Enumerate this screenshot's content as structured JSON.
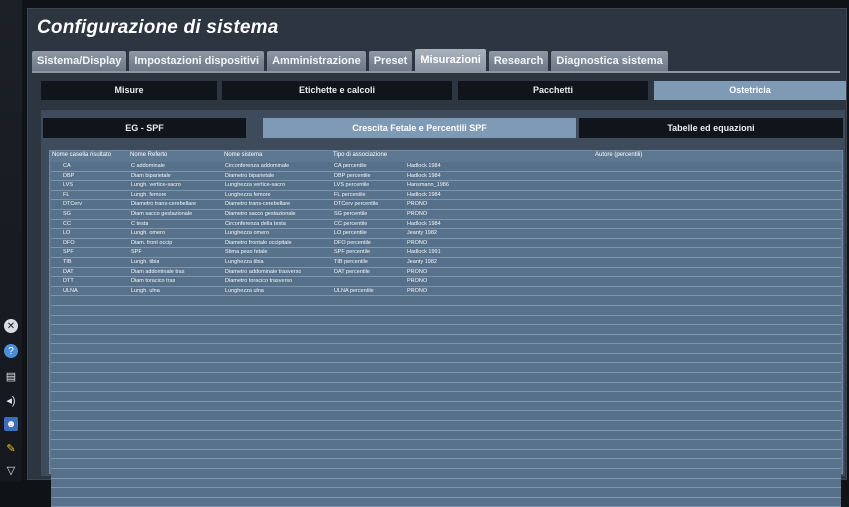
{
  "title": "Configurazione di sistema",
  "top_tabs": [
    "Sistema/Display",
    "Impostazioni dispositivi",
    "Amministrazione",
    "Preset",
    "Misurazioni",
    "Research",
    "Diagnostica sistema"
  ],
  "active_top_tab": "Misurazioni",
  "sub_tabs": [
    "Misure",
    "Etichette e calcoli",
    "Pacchetti",
    "Ostetricia"
  ],
  "active_sub_tab": "Ostetricia",
  "inner_tabs": [
    "EG - SPF",
    "Crescita Fetale e Percentili SPF",
    "Tabelle ed equazioni"
  ],
  "active_inner_tab": "Crescita Fetale e Percentili SPF",
  "table": {
    "headers": [
      "Nome casella risultato",
      "Nome Referto",
      "Nome sistema",
      "Tipo di associazione",
      "",
      "Autore (percentili)"
    ],
    "rows": [
      [
        "CA",
        "C addominale",
        "Circonferenza addominale",
        "CA percentile",
        "Hadlock 1984"
      ],
      [
        "DBP",
        "Diam biparietale",
        "Diametro biparietale",
        "DBP percentile",
        "Hadlock 1984"
      ],
      [
        "LVS",
        "Lungh. vertice-sacro",
        "Lunghezza vertice-sacro",
        "LVS percentile",
        "Hansmann_1986"
      ],
      [
        "FL",
        "Lungh. femore",
        "Lunghezza femore",
        "FL percentile",
        "Hadlock 1984"
      ],
      [
        "DTCerv",
        "Diametro trans-cerebellare",
        "Diametro trans-cerebellare",
        "DTCerv percentile",
        "PRONO"
      ],
      [
        "SG",
        "Diam sacco gestazionale",
        "Diametro sacco gestazionale",
        "SG percentile",
        "PRONO"
      ],
      [
        "CC",
        "C testa",
        "Circonferenza della testa",
        "CC percentile",
        "Hadlock 1984"
      ],
      [
        "LO",
        "Lungh. omero",
        "Lunghezza omero",
        "LO percentile",
        "Jeanty 1982"
      ],
      [
        "DFO",
        "Diam. front occip",
        "Diametro frontale occipitale",
        "DFO percentile",
        "PRONO"
      ],
      [
        "SPF",
        "SPF",
        "Stima peso fetale",
        "SPF percentile",
        "Hadlock 1991"
      ],
      [
        "TIB",
        "Lungh. tibia",
        "Lunghezza tibia",
        "TIB percentile",
        "Jeanty 1982"
      ],
      [
        "DAT",
        "Diam addominale tras",
        "Diametro addominale trasverso",
        "DAT percentile",
        "PRONO"
      ],
      [
        "DTT",
        "Diam toracico tras",
        "Diametro toracico trasverso",
        "",
        "PRONO"
      ],
      [
        "ULNA",
        "Lungh. ulna",
        "Lunghezza ulna",
        "ULNA percentile",
        "PRONO"
      ]
    ]
  },
  "left_icons": [
    "close-icon",
    "help-icon",
    "printer-icon",
    "volume-icon",
    "user-icon",
    "pen-icon",
    "chevron-down-icon"
  ],
  "colors": {
    "panel": "#2c3540",
    "active_tab": "#7f9ab4",
    "table_bg": "#5f7891"
  }
}
